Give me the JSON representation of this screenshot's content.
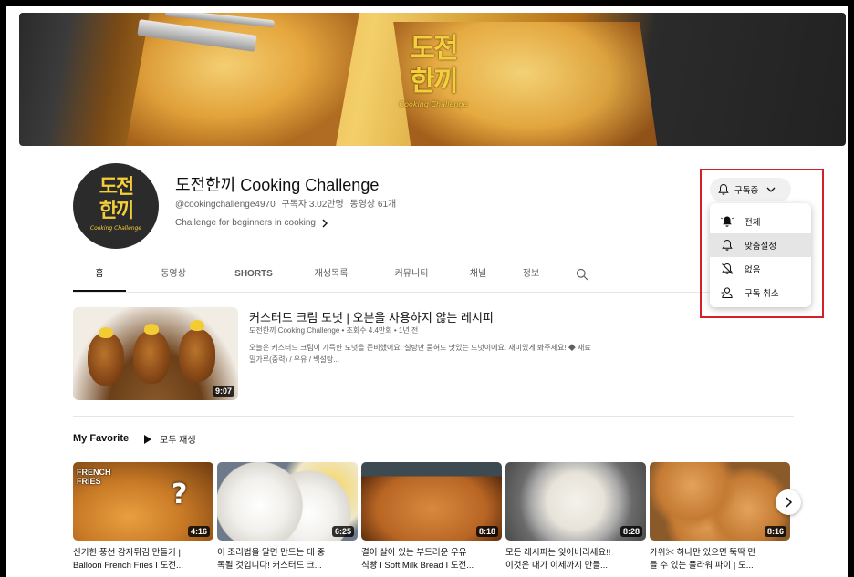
{
  "banner": {
    "logo_text_line1": "도전",
    "logo_text_line2": "한끼",
    "logo_sub": "Cooking Challenge"
  },
  "channel": {
    "avatar_line1": "도전",
    "avatar_line2": "한끼",
    "avatar_sub": "Cooking Challenge",
    "title": "도전한끼 Cooking Challenge",
    "handle": "@cookingchallenge4970",
    "subscribers": "구독자 3.02만명",
    "video_count": "동영상 61개",
    "description": "Challenge for beginners in cooking"
  },
  "tabs": [
    {
      "label": "홈"
    },
    {
      "label": "동영상"
    },
    {
      "label": "SHORTS"
    },
    {
      "label": "재생목록"
    },
    {
      "label": "커뮤니티"
    },
    {
      "label": "채널"
    },
    {
      "label": "정보"
    }
  ],
  "featured": {
    "title": "커스터드 크림 도넛 | 오븐을 사용하지 않는 레시피",
    "meta": "도전한끼 Cooking Challenge • 조회수 4.4만회 • 1년 전",
    "desc_line1": "오늘은 커스터드 크림이 가득한 도넛을 준비했어요! 설탕만 묻혀도 맛있는 도넛이에요. 재미있게 봐주세요! ◆ 재료",
    "desc_line2": "밀가루(중력) / 우유 / 백설탕...",
    "duration": "9:07"
  },
  "playlist": {
    "title": "My Favorite",
    "play_all": "모두 재생",
    "items": [
      {
        "line1": "신기한 풍선 감자튀김 만들기 |",
        "line2": "Balloon French Fries I 도전...",
        "duration": "4:16",
        "badge": "FRENCH FRIES"
      },
      {
        "line1": "이 조리법을 알면 만드는 데 중",
        "line2": "독될 것입니다! 커스터드 크...",
        "duration": "6:25"
      },
      {
        "line1": "결이 살아 있는 부드러운 우유",
        "line2": "식빵 I Soft Milk Bread I 도전...",
        "duration": "8:18"
      },
      {
        "line1": "모든 레시피는 잊어버리세요!!",
        "line2": "이것은 내가 이제까지 만들...",
        "duration": "8:28"
      },
      {
        "line1": "가위✂ 하나만 있으면 뚝딱 만",
        "line2": "들 수 있는 플라워 파이 | 도...",
        "duration": "8:16"
      }
    ]
  },
  "subscribe": {
    "label": "구독중",
    "menu": [
      {
        "label": "전체"
      },
      {
        "label": "맞춤설정"
      },
      {
        "label": "없음"
      },
      {
        "label": "구독 취소"
      }
    ]
  },
  "colors": {
    "highlight_box": "#d62028",
    "logo_yellow": "#f4cf3a"
  }
}
